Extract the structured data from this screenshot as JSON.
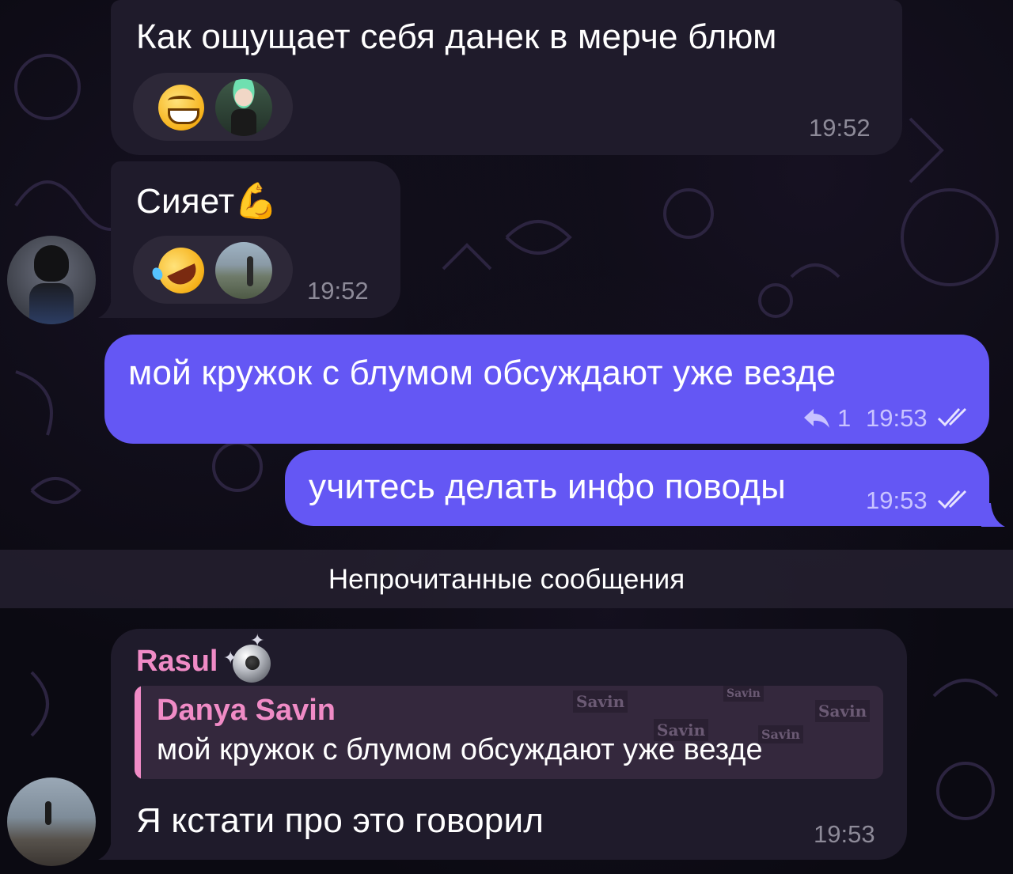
{
  "messages": [
    {
      "text": "Как ощущает себя данек в мерче блюм",
      "time": "19:52",
      "reactions": [
        "grinning-face-emoji",
        "user-avatar-green-cap"
      ]
    },
    {
      "text": "Сияет💪",
      "time": "19:52",
      "reactions": [
        "rolling-on-floor-laughing-emoji",
        "user-avatar-photo"
      ]
    },
    {
      "text": "мой кружок с блумом обсуждают уже везде",
      "time": "19:53",
      "reply_count": "1"
    },
    {
      "text": "учитесь делать инфо поводы",
      "time": "19:53"
    }
  ],
  "unread_divider": "Непрочитанные сообщения",
  "reply_message": {
    "sender": "Rasul",
    "quote_name": "Danya Savin",
    "quote_text": "мой кружок с блумом обсуждают уже везде",
    "text": "Я кстати про это говорил",
    "time": "19:53",
    "quote_watermarks": [
      "Savin",
      "Savin",
      "Savin",
      "Savin",
      "Savin"
    ]
  },
  "colors": {
    "incoming_bubble": "#1f1b2b",
    "outgoing_bubble": "#6457f4",
    "sender_name": "#f08bc6",
    "background": "#0b0a12"
  }
}
